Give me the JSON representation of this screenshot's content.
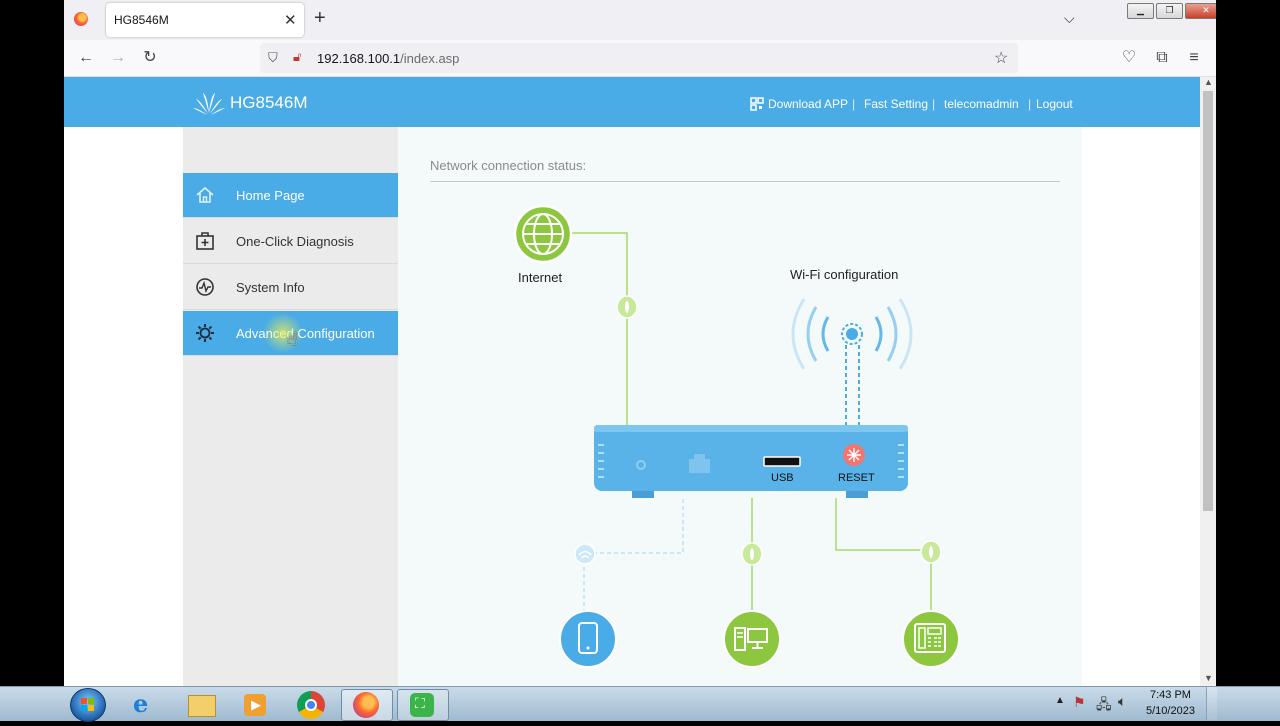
{
  "browser": {
    "tab_title": "HG8546M",
    "tab_close": "✕",
    "new_tab": "+",
    "url_host": "192.168.100.1",
    "url_path": "/index.asp"
  },
  "header": {
    "logo": "HG8546M",
    "links": [
      "Download APP",
      "Fast Setting",
      "telecomadmin",
      "Logout"
    ],
    "separator": "|"
  },
  "sidebar": {
    "items": [
      {
        "label": "Home Page",
        "icon": "home-icon",
        "active": true
      },
      {
        "label": "One-Click Diagnosis",
        "icon": "first-aid-icon",
        "active": false
      },
      {
        "label": "System Info",
        "icon": "pulse-icon",
        "active": false
      },
      {
        "label": "Advanced Configuration",
        "icon": "gear-icon",
        "active": true
      }
    ]
  },
  "main": {
    "status_title": "Network connection status:",
    "internet_label": "Internet",
    "wifi_label": "Wi-Fi configuration",
    "usb_label": "USB",
    "reset_label": "RESET"
  },
  "taskbar": {
    "time": "7:43 PM",
    "date": "5/10/2023"
  },
  "colors": {
    "accent": "#4aace6",
    "green": "#8dc63f",
    "line_green": "#a6d96a"
  }
}
